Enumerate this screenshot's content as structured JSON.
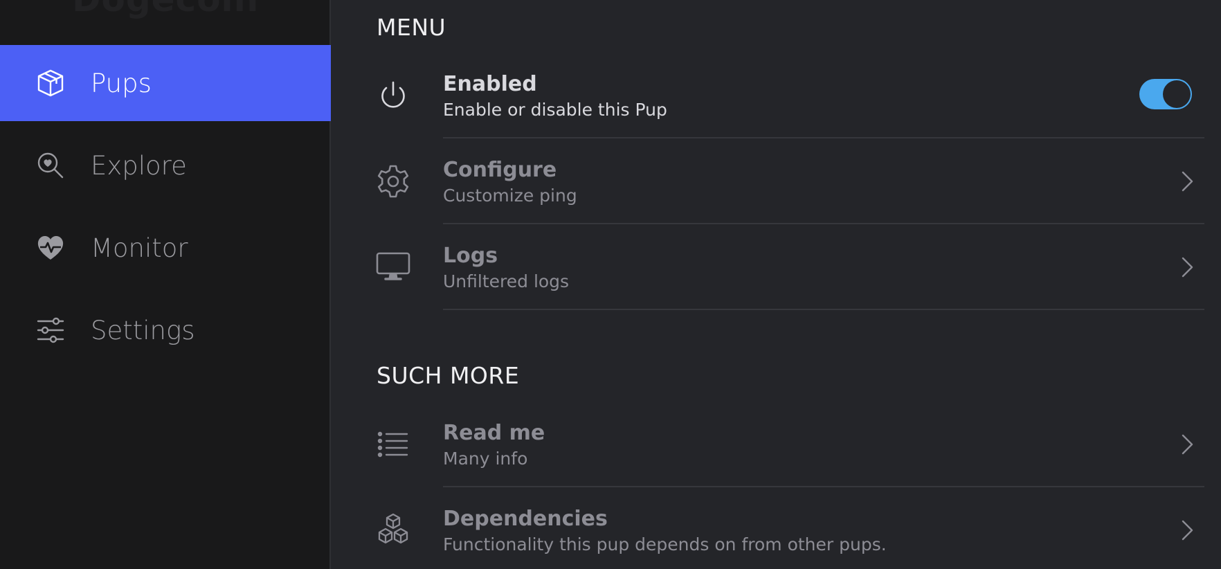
{
  "sidebar": {
    "brand": "Dogecoin",
    "items": [
      {
        "label": "Pups",
        "icon": "box-icon",
        "active": true
      },
      {
        "label": "Explore",
        "icon": "search-heart-icon",
        "active": false
      },
      {
        "label": "Monitor",
        "icon": "heart-pulse-icon",
        "active": false
      },
      {
        "label": "Settings",
        "icon": "sliders-icon",
        "active": false
      }
    ]
  },
  "main": {
    "menu_heading": "MENU",
    "menu": [
      {
        "title": "Enabled",
        "subtitle": "Enable or disable this Pup",
        "icon": "power-icon",
        "toggle_on": true
      },
      {
        "title": "Configure",
        "subtitle": "Customize ping",
        "icon": "gear-icon"
      },
      {
        "title": "Logs",
        "subtitle": "Unfiltered logs",
        "icon": "monitor-icon"
      }
    ],
    "more_heading": "SUCH MORE",
    "more": [
      {
        "title": "Read me",
        "subtitle": "Many info",
        "icon": "list-icon"
      },
      {
        "title": "Dependencies",
        "subtitle": "Functionality this pup depends on from other pups.",
        "icon": "boxes-icon"
      }
    ]
  },
  "colors": {
    "accent": "#4c60f5",
    "toggle": "#4aa8ee",
    "sidebar_bg": "#19191a",
    "main_bg": "#242529"
  }
}
